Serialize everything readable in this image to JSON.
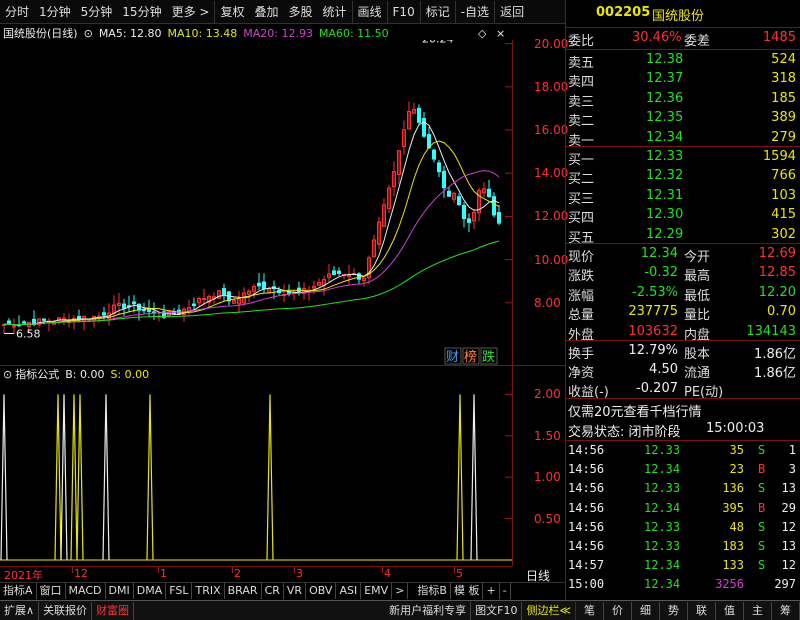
{
  "toolbar": {
    "items": [
      "分时",
      "1分钟",
      "5分钟",
      "15分钟",
      "更多 >",
      "复权",
      "叠加",
      "多股",
      "统计",
      "画线",
      "F10",
      "标记",
      "-自选",
      "返回"
    ]
  },
  "chart": {
    "stock_title": "国统股份(日线)",
    "ma5": "MA5: 12.80",
    "ma10": "MA10: 13.48",
    "ma20": "MA20: 12.93",
    "ma60": "MA60: 11.50",
    "price_ticks": [
      "20.00",
      "18.00",
      "16.00",
      "14.00",
      "12.00",
      "10.00",
      "8.00"
    ],
    "high_label": "20.24",
    "low_label": "6.58",
    "badges": [
      "财",
      "榜",
      "跌"
    ],
    "chart_data": {
      "type": "line",
      "title": "",
      "ylim": [
        6,
        21
      ],
      "high": 20.24,
      "low": 6.58
    }
  },
  "indicator": {
    "title": "指标公式",
    "b_value": "B: 0.00",
    "s_value": "S: 0.00",
    "ticks": [
      "2.00",
      "1.50",
      "1.00",
      "0.50"
    ]
  },
  "xaxis": {
    "labels": [
      "2021年",
      "12",
      "1",
      "2",
      "3",
      "4",
      "5"
    ],
    "period": "日线"
  },
  "tabs": [
    "指标A",
    "窗口",
    "MACD",
    "DMI",
    "DMA",
    "FSL",
    "TRIX",
    "BRAR",
    "CR",
    "VR",
    "OBV",
    "ASI",
    "EMV",
    ">",
    "指标B",
    "模 板",
    "+",
    "-"
  ],
  "bottom": {
    "items": [
      "扩展∧",
      "关联报价",
      "财富圈"
    ],
    "right_items": [
      "新用户福利专享",
      "图文F10",
      "侧边栏≪",
      "笔",
      "价",
      "细",
      "势",
      "联",
      "值",
      "主",
      "筹"
    ]
  },
  "quote": {
    "code": "002205",
    "name": "国统股份",
    "weibi_label": "委比",
    "weibi": "30.46%",
    "weicha_label": "委差",
    "weicha": "1485",
    "asks": [
      {
        "label": "卖五",
        "price": "12.38",
        "vol": "524"
      },
      {
        "label": "卖四",
        "price": "12.37",
        "vol": "318"
      },
      {
        "label": "卖三",
        "price": "12.36",
        "vol": "185"
      },
      {
        "label": "卖二",
        "price": "12.35",
        "vol": "389"
      },
      {
        "label": "卖一",
        "price": "12.34",
        "vol": "279"
      }
    ],
    "bids": [
      {
        "label": "买一",
        "price": "12.33",
        "vol": "1594"
      },
      {
        "label": "买二",
        "price": "12.32",
        "vol": "766"
      },
      {
        "label": "买三",
        "price": "12.31",
        "vol": "103"
      },
      {
        "label": "买四",
        "price": "12.30",
        "vol": "415"
      },
      {
        "label": "买五",
        "price": "12.29",
        "vol": "302"
      }
    ],
    "stats": [
      {
        "l1": "现价",
        "v1": "12.34",
        "c1": "green",
        "l2": "今开",
        "v2": "12.69",
        "c2": "red"
      },
      {
        "l1": "涨跌",
        "v1": "-0.32",
        "c1": "green",
        "l2": "最高",
        "v2": "12.85",
        "c2": "red"
      },
      {
        "l1": "涨幅",
        "v1": "-2.53%",
        "c1": "green",
        "l2": "最低",
        "v2": "12.20",
        "c2": "green"
      },
      {
        "l1": "总量",
        "v1": "237775",
        "c1": "yellow",
        "l2": "量比",
        "v2": "0.70",
        "c2": "yellow"
      },
      {
        "l1": "外盘",
        "v1": "103632",
        "c1": "red",
        "l2": "内盘",
        "v2": "134143",
        "c2": "green"
      }
    ],
    "stats2": [
      {
        "l1": "换手",
        "v1": "12.79%",
        "l2": "股本",
        "v2": "1.86亿"
      },
      {
        "l1": "净资",
        "v1": "4.50",
        "l2": "流通",
        "v2": "1.86亿"
      },
      {
        "l1": "收益(-)",
        "v1": "-0.207",
        "l2": "PE(动)",
        "v2": ""
      }
    ],
    "promo": "仅需20元查看千档行情",
    "status_label": "交易状态: 闭市阶段",
    "status_time": "15:00:03",
    "ticks": [
      {
        "time": "14:56",
        "price": "12.33",
        "vol": "35",
        "bs": "S",
        "n": "1"
      },
      {
        "time": "14:56",
        "price": "12.34",
        "vol": "23",
        "bs": "B",
        "n": "3"
      },
      {
        "time": "14:56",
        "price": "12.33",
        "vol": "136",
        "bs": "S",
        "n": "13"
      },
      {
        "time": "14:56",
        "price": "12.34",
        "vol": "395",
        "bs": "B",
        "n": "29"
      },
      {
        "time": "14:56",
        "price": "12.33",
        "vol": "48",
        "bs": "S",
        "n": "12"
      },
      {
        "time": "14:56",
        "price": "12.33",
        "vol": "183",
        "bs": "S",
        "n": "13"
      },
      {
        "time": "14:57",
        "price": "12.34",
        "vol": "133",
        "bs": "S",
        "n": "12"
      },
      {
        "time": "15:00",
        "price": "12.34",
        "vol": "3256",
        "bs": "",
        "n": "297"
      }
    ]
  }
}
